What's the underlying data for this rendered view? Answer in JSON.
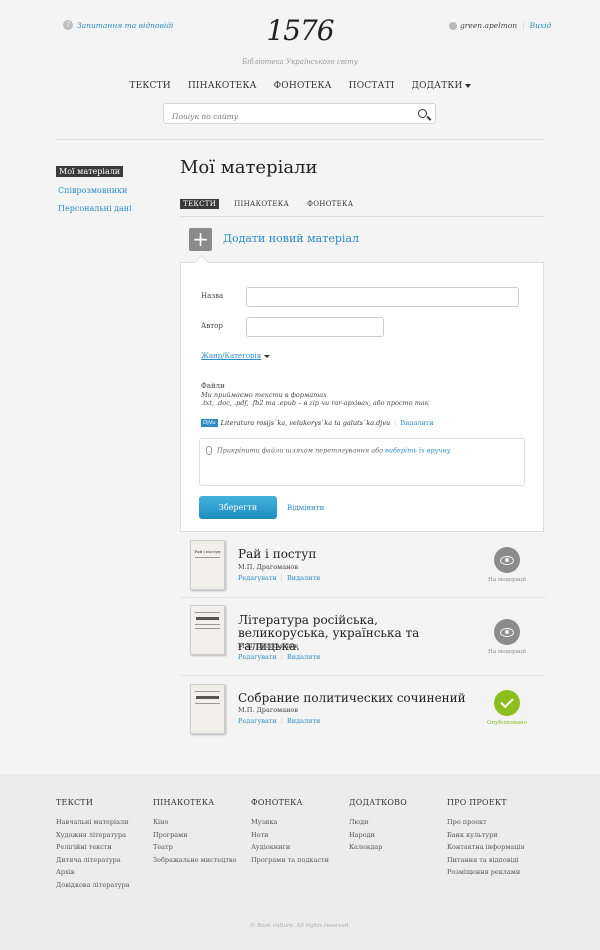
{
  "header": {
    "help_label": "Запитання та відповіді",
    "help_icon": "question-icon",
    "logo": "1576",
    "tagline": "Бібліотека Українського світу",
    "username": "green.apelmon",
    "logout_label": "Вихід"
  },
  "nav": {
    "items": [
      "ТЕКСТИ",
      "ПІНАКОТЕКА",
      "ФОНОТЕКА",
      "ПОСТАТІ",
      "ДОДАТКИ"
    ]
  },
  "search": {
    "placeholder": "Пошук по сайту"
  },
  "sidebar": {
    "items": [
      "Мої матеріали",
      "Співрозмовники",
      "Персональні дані"
    ]
  },
  "main": {
    "title": "Мої матеріали",
    "tabs": [
      "ТЕКСТИ",
      "ПІНАКОТЕКА",
      "ФОНОТЕКА"
    ],
    "add_label": "Додати новий матеріал"
  },
  "form": {
    "name_label": "Назва",
    "author_label": "Автор",
    "genre_label": "Жанр/Категорія",
    "files_label": "Файли",
    "files_hint_1": "Ми приймаємо тексти в форматах",
    "files_hint_2": ".txt, .doc, .pdf, .fb2 та .epub – в zip чи rar-архівах, або просто так",
    "file_badge": "DjVu",
    "file_name": "Literatura rosijs`ka, velukorys`ka ta galuts`ka.djvu",
    "file_delete": "Видалити",
    "drop_text": "Прикріпити файли шляхом перетягування або ",
    "drop_link": "виберіть їх вручну",
    "save_label": "Зберегти",
    "cancel_label": "Відмінити"
  },
  "items": [
    {
      "title": "Рай і поступ",
      "author": "М.П. Драгоманов",
      "edit": "Редагувати",
      "delete": "Видалити",
      "status": "На модерації",
      "status_icon": "eye-icon",
      "thumb_title": "Рай і поступ"
    },
    {
      "title": "Література російська, великоруська, українська та галицька.",
      "author": "М.П. Драгоманов",
      "edit": "Редагувати",
      "delete": "Видалити",
      "status": "На модерації",
      "status_icon": "eye-icon"
    },
    {
      "title": "Собрание политических сочинений",
      "author": "М.П. Драгоманов",
      "edit": "Редагувати",
      "delete": "Видалити",
      "status": "Опубліковано",
      "status_icon": "check-icon"
    }
  ],
  "footer": {
    "columns": [
      {
        "title": "ТЕКСТИ",
        "links": [
          "Навчальні матеріали",
          "Художня література",
          "Релігійні тексти",
          "Дитяча література",
          "Архів",
          "Довідкова література"
        ]
      },
      {
        "title": "ПІНАКОТЕКА",
        "links": [
          "Кіно",
          "Програми",
          "Театр",
          "Зображальне мистецтво"
        ]
      },
      {
        "title": "ФОНОТЕКА",
        "links": [
          "Музика",
          "Ноти",
          "Аудіокниги",
          "Програми та подкасти"
        ]
      },
      {
        "title": "ДОДАТКОВО",
        "links": [
          "Люди",
          "Народи",
          "Календар"
        ]
      },
      {
        "title": "ПРО ПРОЕКТ",
        "links": [
          "Про проект",
          "Банк культури",
          "Контактна інформація",
          "Питання та відповіді",
          "Розміщення реклами"
        ]
      }
    ],
    "copyright": "© Book culture. All rights reserved."
  },
  "colors": {
    "accent": "#2b8bc6",
    "published": "#8cbf1e",
    "moderation": "#8c8c8c"
  }
}
